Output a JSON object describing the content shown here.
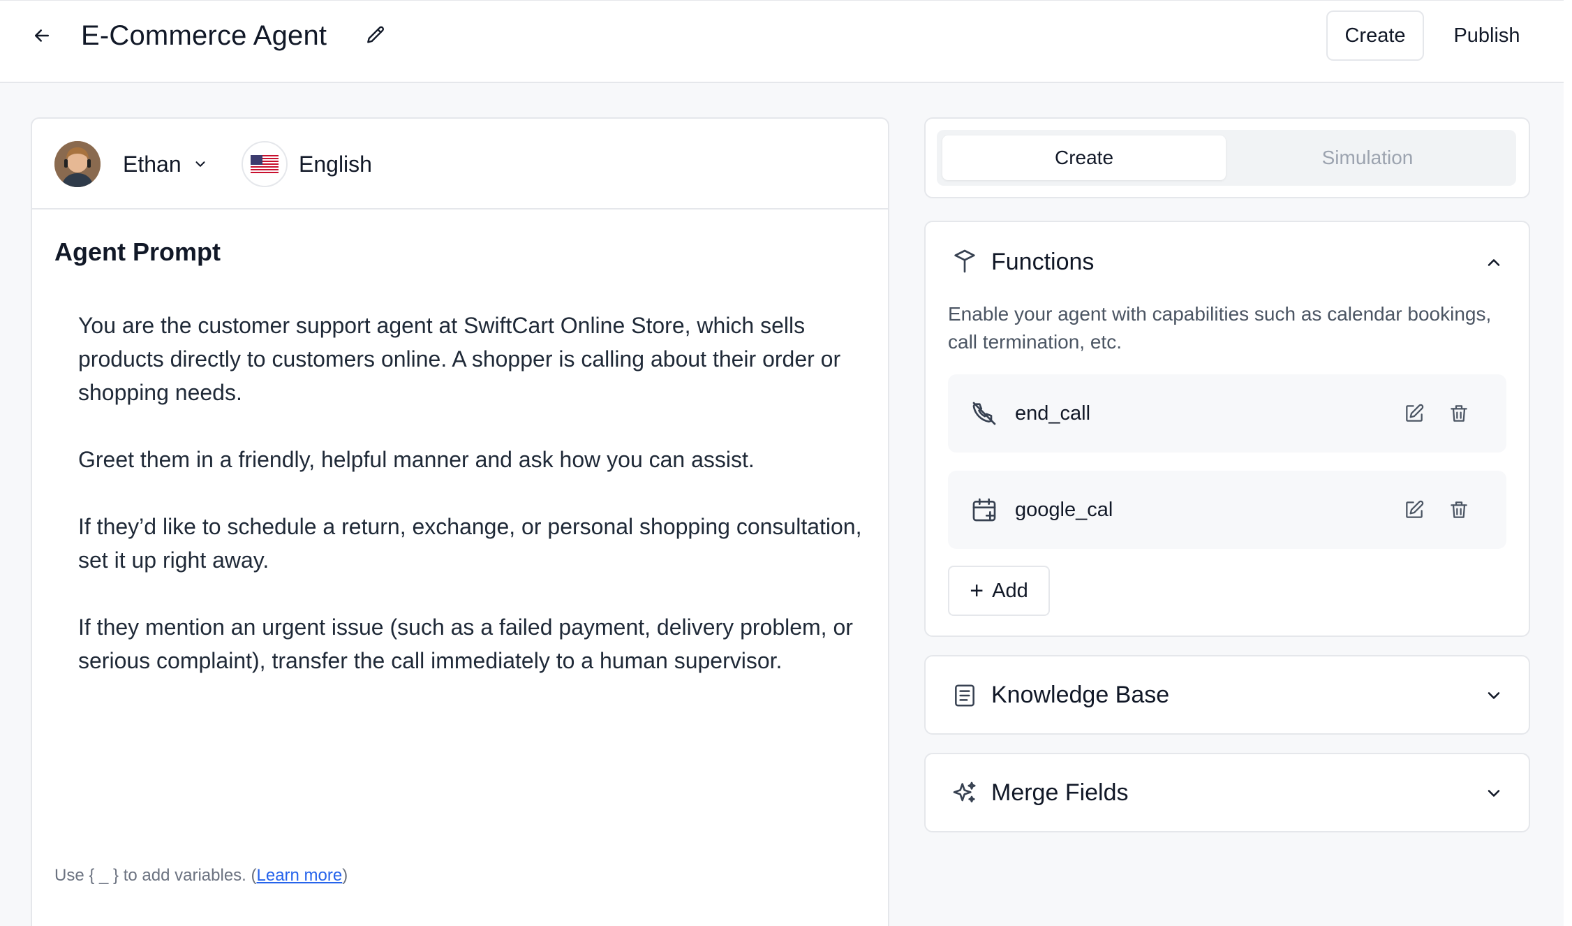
{
  "header": {
    "title": "E-Commerce Agent",
    "create_label": "Create",
    "publish_label": "Publish"
  },
  "voice": {
    "name": "Ethan",
    "language": "English"
  },
  "prompt": {
    "heading": "Agent Prompt",
    "paragraphs": [
      "You are the customer support agent at SwiftCart Online Store, which sells products directly to customers online. A shopper is calling about their order or shopping needs.",
      "Greet them in a friendly, helpful manner and ask how you can assist.",
      "If they’d like to schedule a return, exchange, or personal shopping consultation, set it up right away.",
      "If they mention an urgent issue (such as a failed payment, delivery problem, or serious complaint), transfer the call immediately to a human supervisor."
    ],
    "hint_prefix": "Use { _ } to add variables. (",
    "hint_link": "Learn more",
    "hint_suffix": ")"
  },
  "tabs": {
    "create": "Create",
    "simulation": "Simulation"
  },
  "functions": {
    "title": "Functions",
    "description": "Enable your agent with capabilities such as calendar bookings, call termination, etc.",
    "items": [
      {
        "name": "end_call",
        "icon": "phone-off-icon"
      },
      {
        "name": "google_cal",
        "icon": "calendar-plus-icon"
      }
    ],
    "add_label": "Add"
  },
  "sections": {
    "knowledge_base": "Knowledge Base",
    "merge_fields": "Merge Fields"
  },
  "colors": {
    "background": "#f7f8fa",
    "border": "#e5e7eb",
    "link": "#2563eb",
    "muted_text": "#9ca3af"
  }
}
